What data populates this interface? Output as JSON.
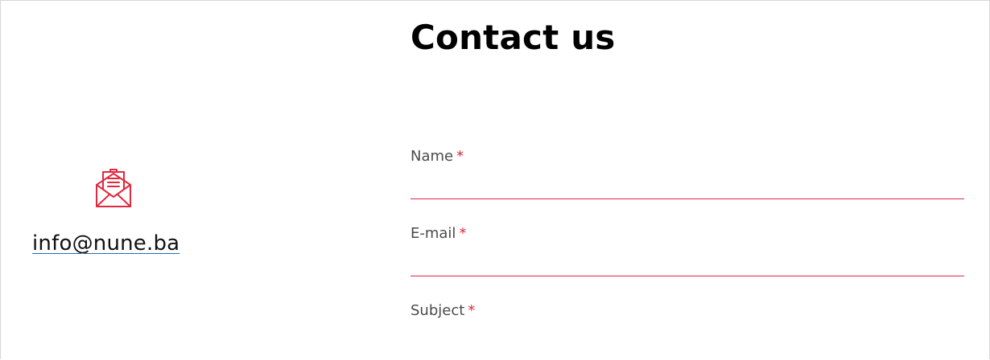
{
  "contact": {
    "email": "info@nune.ba",
    "icon": "open-envelope-letter-icon"
  },
  "form": {
    "title": "Contact us",
    "required_marker": "*",
    "fields": [
      {
        "label": "Name",
        "value": "",
        "placeholder": ""
      },
      {
        "label": "E-mail",
        "value": "",
        "placeholder": ""
      },
      {
        "label": "Subject",
        "value": "",
        "placeholder": ""
      }
    ]
  },
  "colors": {
    "accent": "#e0293e",
    "label": "#4a4a4a",
    "title": "#000000",
    "link_underline": "#1f6fb5"
  }
}
